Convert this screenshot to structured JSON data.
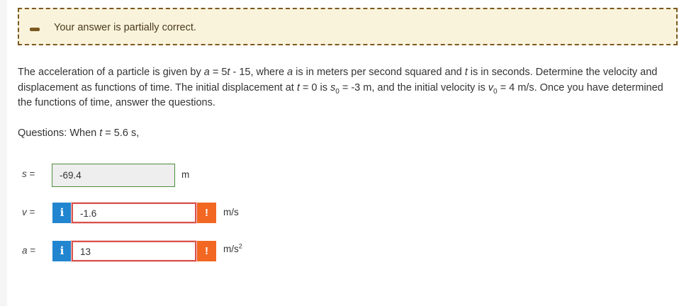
{
  "feedback": {
    "icon": "minus-icon",
    "message": "Your answer is partially correct."
  },
  "problem": {
    "p1": "The acceleration of a particle is given by ",
    "a_var": "a",
    "p2": " = 5",
    "t_var1": "t",
    "p3": " - 15, where ",
    "a_var2": "a",
    "p4": " is in meters per second squared and ",
    "t_var2": "t",
    "p5": " is in seconds. Determine the velocity and displacement as functions of time. The initial displacement at ",
    "t_var3": "t",
    "p6": " = 0 is ",
    "s_var": "s",
    "s_sub": "0",
    "p7": " = -3 m, and the initial velocity is ",
    "v_var": "v",
    "v_sub": "0",
    "p8": " = 4 m/s. Once you have determined the functions of time, answer the questions."
  },
  "questions": {
    "prefix": "Questions: When ",
    "t_var": "t",
    "suffix": " = 5.6 s,"
  },
  "answers": [
    {
      "var": "s",
      "eq": " =",
      "value": "-69.4",
      "unit": "m",
      "status": "correct"
    },
    {
      "var": "v",
      "eq": " =",
      "value": "-1.6",
      "unit": "m/s",
      "status": "incorrect",
      "info_label": "i",
      "err_label": "!"
    },
    {
      "var": "a",
      "eq": " =",
      "value": "13",
      "unit_base": "m/s",
      "unit_exp": "2",
      "status": "incorrect",
      "info_label": "i",
      "err_label": "!"
    }
  ],
  "colors": {
    "feedback_bg": "#faf3dc",
    "feedback_border": "#7a5a20",
    "info_blue": "#2185d0",
    "error_orange": "#f26722",
    "correct_green": "#4a8c3a",
    "incorrect_red": "#d9534f"
  }
}
